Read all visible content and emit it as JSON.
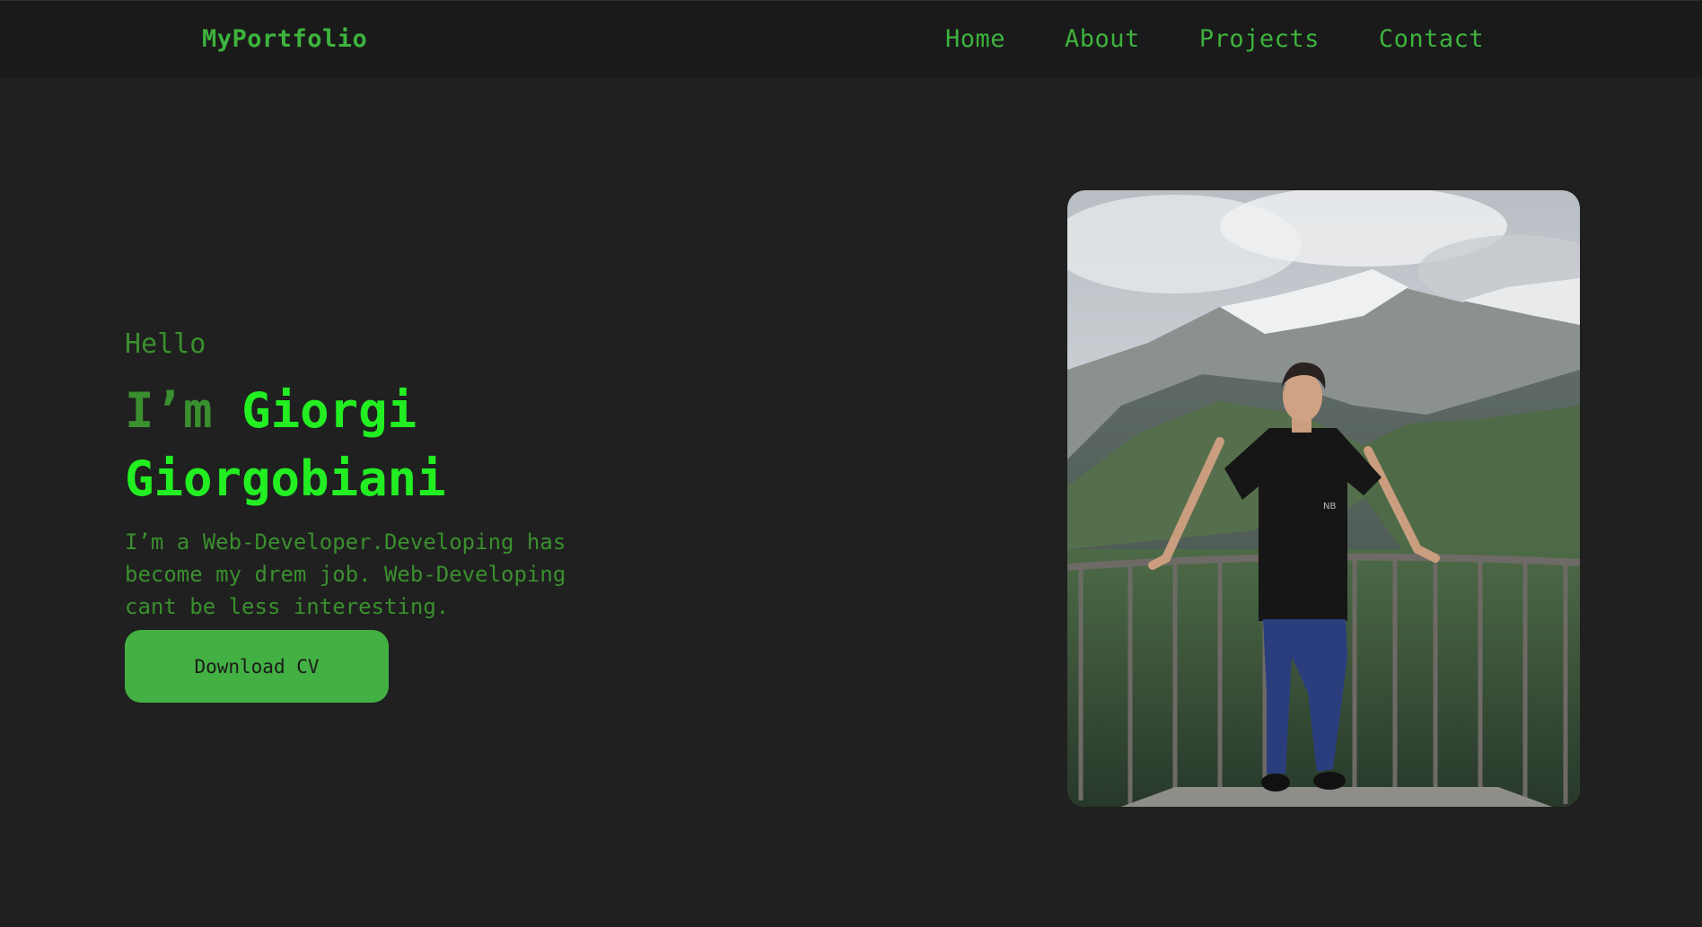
{
  "navbar": {
    "brand": "MyPortfolio",
    "links": [
      {
        "label": "Home"
      },
      {
        "label": "About"
      },
      {
        "label": "Projects"
      },
      {
        "label": "Contact"
      }
    ]
  },
  "hero": {
    "greeting": "Hello",
    "title_prefix": "I’m",
    "name_first": "Giorgi",
    "name_last": "Giorgobiani",
    "description": "I’m a Web-Developer.Developing has become my drem job. Web-Developing cant be less interesting.",
    "button_label": "Download CV"
  },
  "photo": {
    "subject": "person-standing-at-railing-with-mountains"
  },
  "colors": {
    "background": "#202020",
    "navbar": "#1a1a1a",
    "accent": "#43b043",
    "bright_green": "#22ee22",
    "muted_green": "#3a8f2e"
  }
}
